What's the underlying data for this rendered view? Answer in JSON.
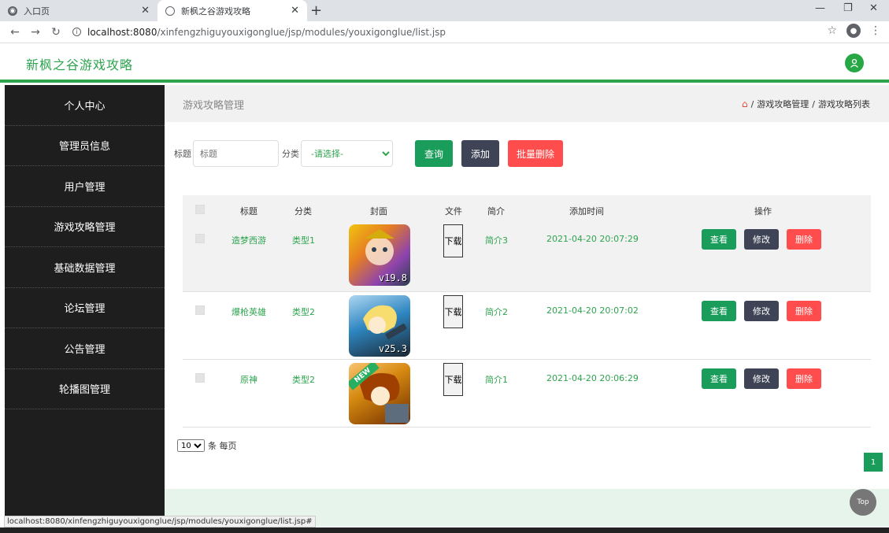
{
  "browser": {
    "tabs": [
      {
        "title": "入口页",
        "active": false
      },
      {
        "title": "新枫之谷游戏攻略",
        "active": true
      }
    ],
    "url_host": "localhost:8080",
    "url_path": "/xinfengzhiguyouxigonglue/jsp/modules/youxigonglue/list.jsp",
    "status_url": "localhost:8080/xinfengzhiguyouxigonglue/jsp/modules/youxigonglue/list.jsp#"
  },
  "header": {
    "title": "新枫之谷游戏攻略"
  },
  "sidebar": {
    "items": [
      {
        "label": "个人中心"
      },
      {
        "label": "管理员信息"
      },
      {
        "label": "用户管理"
      },
      {
        "label": "游戏攻略管理"
      },
      {
        "label": "基础数据管理"
      },
      {
        "label": "论坛管理"
      },
      {
        "label": "公告管理"
      },
      {
        "label": "轮播图管理"
      }
    ]
  },
  "main": {
    "page_title": "游戏攻略管理",
    "breadcrumb": {
      "section": "游戏攻略管理",
      "sep": "/",
      "current": "游戏攻略列表"
    },
    "filters": {
      "title_label": "标题",
      "title_placeholder": "标题",
      "category_label": "分类",
      "category_selected": "-请选择-",
      "search_label": "查询",
      "add_label": "添加",
      "batch_delete_label": "批量删除"
    },
    "table": {
      "headers": {
        "title": "标题",
        "category": "分类",
        "cover": "封面",
        "file": "文件",
        "intro": "简介",
        "added": "添加时间",
        "ops": "操作"
      },
      "rows": [
        {
          "title": "造梦西游",
          "category": "类型1",
          "file": "下载",
          "intro": "简介3",
          "added": "2021-04-20 20:07:29",
          "version": "v19.8",
          "cover_color": "#c0392b"
        },
        {
          "title": "爆枪英雄",
          "category": "类型2",
          "file": "下载",
          "intro": "简介2",
          "added": "2021-04-20 20:07:02",
          "version": "v25.3",
          "cover_color": "#2e86c1"
        },
        {
          "title": "原神",
          "category": "类型2",
          "file": "下载",
          "intro": "简介1",
          "added": "2021-04-20 20:06:29",
          "badge": "NEW",
          "cover_color": "#d68910"
        }
      ],
      "view_label": "查看",
      "edit_label": "修改",
      "delete_label": "删除"
    },
    "pager": {
      "page_size": "10",
      "per_page_label": "条 每页",
      "current_page": "1"
    },
    "top_label": "Top"
  },
  "colors": {
    "accent": "#2ea44f",
    "danger": "#ff4c4c",
    "dark": "#3e4456",
    "sidebar": "#1e1e1e"
  }
}
